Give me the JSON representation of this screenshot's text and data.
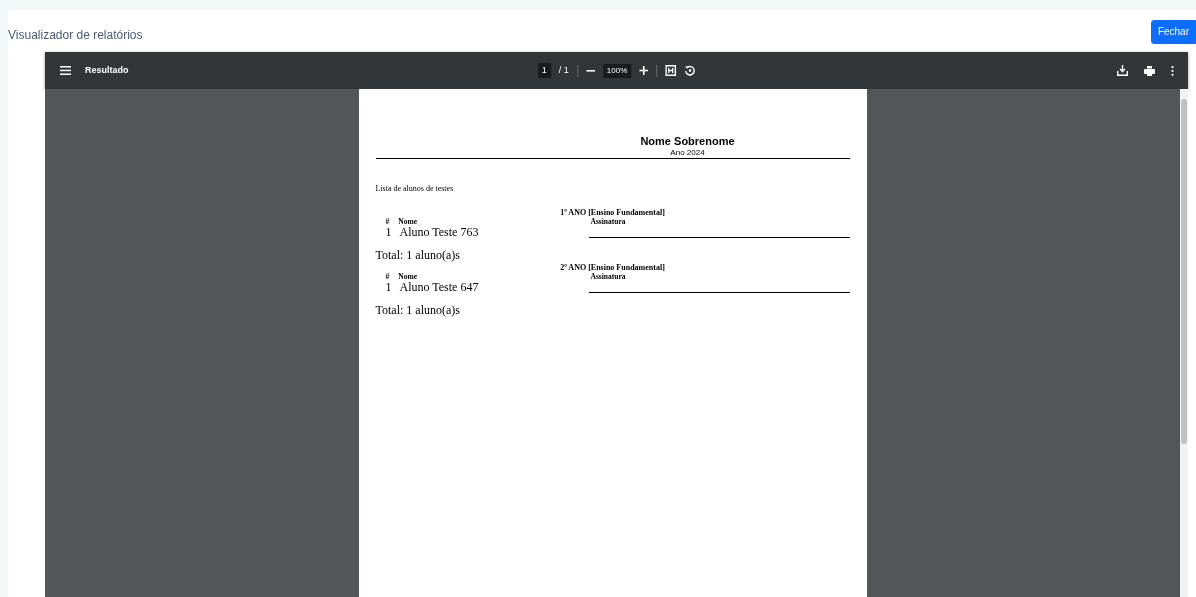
{
  "header": {
    "title": "Visualizador de relatórios",
    "close_button": "Fechar"
  },
  "viewer": {
    "toolbar": {
      "title": "Resultado",
      "page_current": "1",
      "page_total": "/ 1",
      "zoom": "100%"
    },
    "document": {
      "name": "Nome Sobrenome",
      "year": "Ano 2024",
      "list_title": "Lista de alunos de testes",
      "groups": [
        {
          "title": "1º ANO [Ensino Fundamental]",
          "columns": [
            "#",
            "Nome",
            "Assinatura"
          ],
          "rows": [
            {
              "number": "1",
              "name": "Aluno Teste 763"
            }
          ],
          "total": "Total: 1 aluno(a)s"
        },
        {
          "title": "2º ANO [Ensino Fundamental]",
          "columns": [
            "#",
            "Nome",
            "Assinatura"
          ],
          "rows": [
            {
              "number": "1",
              "name": "Aluno Teste 647"
            }
          ],
          "total": "Total: 1 aluno(a)s"
        }
      ]
    }
  }
}
